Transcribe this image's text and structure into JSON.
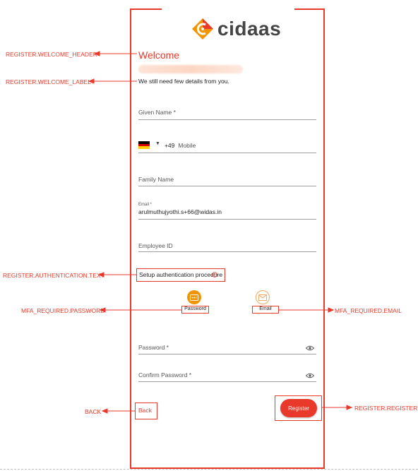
{
  "brand": {
    "name": "cidaas"
  },
  "register": {
    "welcome_header": "Welcome",
    "welcome_label": "We still need few details from you.",
    "fields": {
      "given_name": "Given Name *",
      "country_code": "+49",
      "mobile": "Mobile",
      "family_name": "Family Name",
      "email_label": "Email *",
      "email_value": "arulmuthujyothi.s+66@widas.in",
      "employee_id": "Employee ID",
      "password": "Password *",
      "confirm_password": "Confirm Password *"
    },
    "auth_text": "Setup authentication procedure",
    "mfa": {
      "password": "Password",
      "email": "Email"
    },
    "back": "Back",
    "register_button": "Register"
  },
  "annotations": {
    "welcome_header": "REGISTER.WELCOME_HEADER",
    "welcome_label": "REGISTER.WELCOME_LABEL",
    "auth_text": "REGISTER.AUTHENTICATION.TEXT",
    "mfa_password": "MFA_REQUIRED.PASSWORD",
    "mfa_email": "MFA_REQUIRED.EMAIL",
    "back": "BACK",
    "register": "REGISTER.REGISTER"
  },
  "colors": {
    "accent": "#e8392a",
    "mfa_orange": "#f29400",
    "flag_black": "#000000",
    "flag_red": "#dd0000",
    "flag_gold": "#ffce00"
  }
}
